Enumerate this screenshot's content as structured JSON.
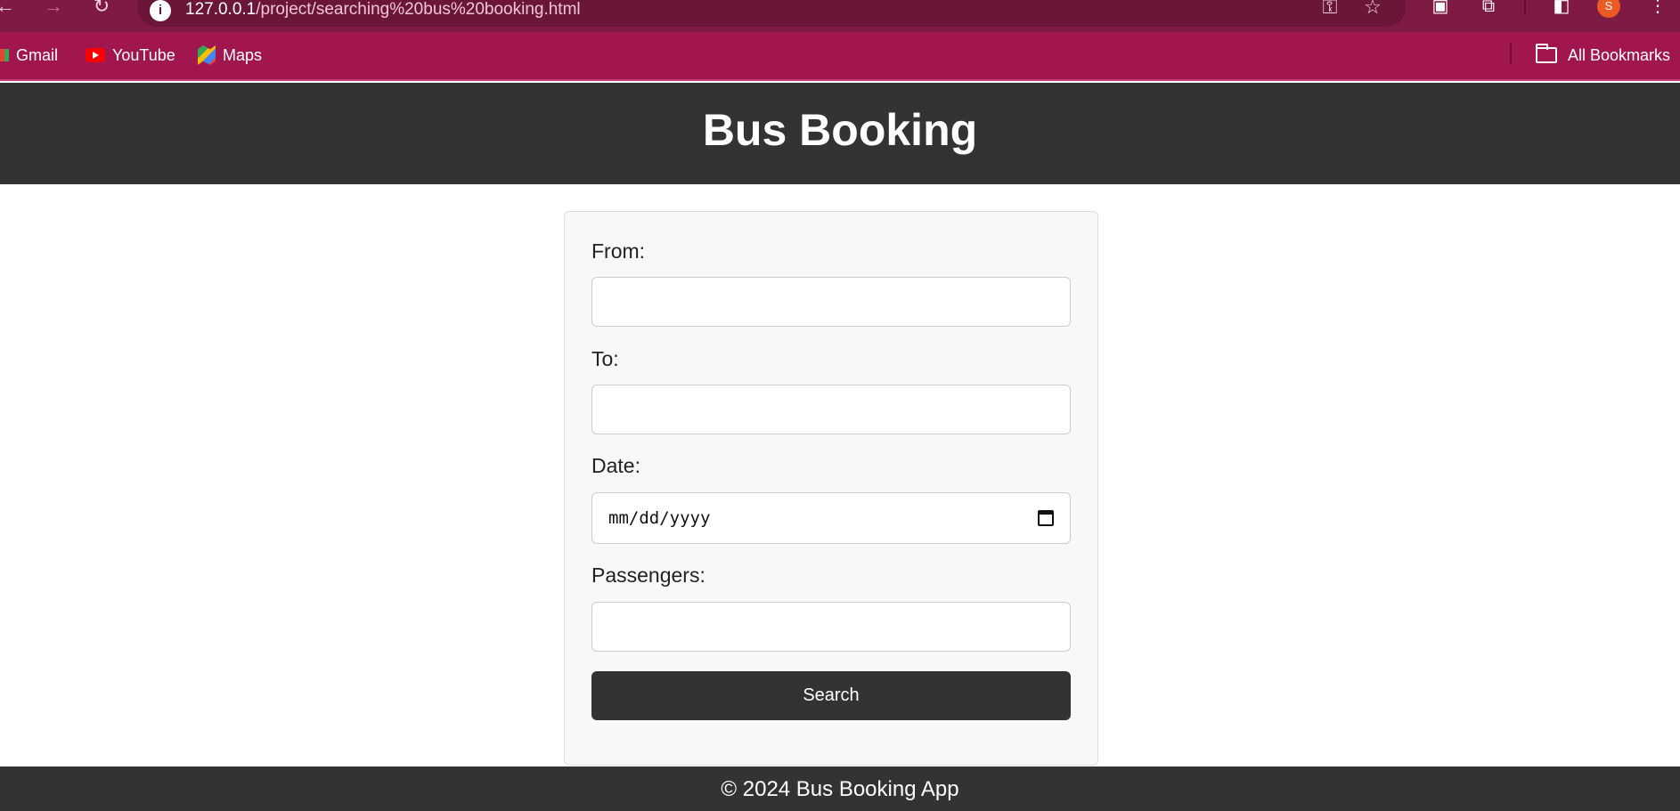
{
  "browser": {
    "url_host": "127.0.0.1",
    "url_path": "/project/searching%20bus%20booking.html",
    "profile_initial": "S",
    "bookmarks": [
      {
        "label": "Gmail",
        "icon": "gmail-icon"
      },
      {
        "label": "YouTube",
        "icon": "youtube-icon"
      },
      {
        "label": "Maps",
        "icon": "maps-icon"
      }
    ],
    "all_bookmarks_label": "All Bookmarks"
  },
  "header": {
    "title": "Bus Booking"
  },
  "form": {
    "from_label": "From:",
    "from_value": "",
    "to_label": "To:",
    "to_value": "",
    "date_label": "Date:",
    "date_placeholder": "mm/dd/yyyy",
    "passengers_label": "Passengers:",
    "passengers_value": "",
    "search_label": "Search"
  },
  "footer": {
    "text": "© 2024 Bus Booking App"
  },
  "colors": {
    "browser_toolbar": "#7e1a44",
    "bookmarks_bar": "#a1164f",
    "header_bg": "#333333",
    "button_bg": "#333333",
    "card_bg": "#f8f8f8"
  }
}
